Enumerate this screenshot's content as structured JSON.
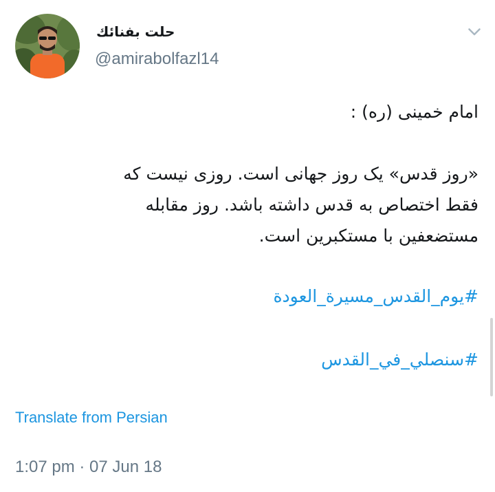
{
  "author": {
    "display_name": "حلت بفنائك",
    "handle": "@amirabolfazl14"
  },
  "tweet": {
    "text_lines": [
      "امام خمینی (ره) :",
      "",
      "«روز قدس» یک روز جهانی است. روزی نیست که",
      "فقط اختصاص به قدس داشته باشد. روز مقابله",
      "مستضعفین با مستکبرین است."
    ],
    "hashtags": [
      "#يوم_القدس_مسيرة_العودة",
      "#سنصلي_في_القدس"
    ]
  },
  "translate_label": "Translate from Persian",
  "timestamp": "1:07 pm · 07 Jun 18",
  "icons": {
    "menu": "chevron-down-icon"
  },
  "colors": {
    "link": "#1b95e0",
    "secondary_text": "#657786",
    "primary_text": "#14171a"
  }
}
